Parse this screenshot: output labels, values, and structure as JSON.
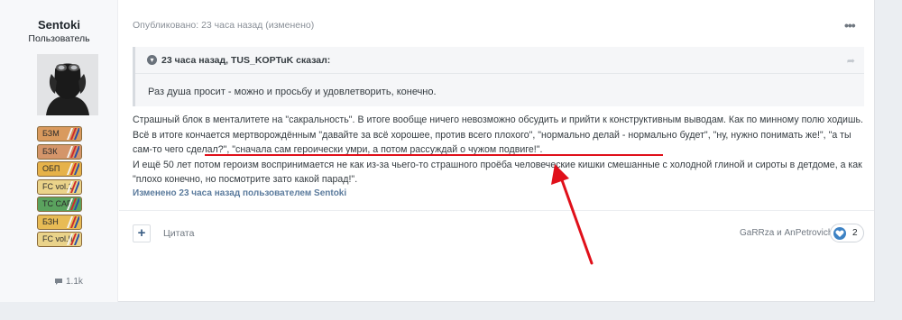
{
  "author": {
    "name": "Sentoki",
    "role": "Пользователь",
    "badges": [
      {
        "label": "БЗМ",
        "color": "#d99a5e"
      },
      {
        "label": "БЗК",
        "color": "#d4956a"
      },
      {
        "label": "ОБП",
        "color": "#e6b24a"
      },
      {
        "label": "FC vol.1",
        "color": "#ead38a"
      },
      {
        "label": "TC CAP",
        "color": "#5aa25e"
      },
      {
        "label": "БЗН",
        "color": "#e8bb55"
      },
      {
        "label": "FC vol.II",
        "color": "#ead38a"
      }
    ],
    "posts_count": "1.1k"
  },
  "post": {
    "meta": "Опубликовано: 23 часа назад (изменено)",
    "quote": {
      "header": "23 часа назад, TUS_KOPTuK сказал:",
      "body": "Раз душа просит - можно и просьбу и удовлетворить, конечно."
    },
    "paragraphs": [
      "Страшный блок в менталитете на \"сакральность\". В итоге вообще ничего невозможно обсудить и прийти к конструктивным выводам. Как по минному полю ходишь. Всё в итоге кончается мертворождённым \"давайте за всё хорошее, против всего плохого\", \"нормально делай - нормально будет\", \"ну, нужно понимать же!\", \"а ты сам-то чего сделал?\", \"сначала сам героически умри, а потом рассуждай о чужом подвиге!\".",
      "И ещё 50 лет потом героизм воспринимается не как из-за чьего-то страшного проёба человеческие кишки смешанные с холодной глиной и сироты в детдоме, а как \"плохо конечно, но посмотрите зато какой парад!\"."
    ],
    "edited": "Изменено 23 часа назад пользователем Sentoki"
  },
  "footer": {
    "quote_label": "Цитата",
    "reactors": "GaRRza и AnPetrovich",
    "reaction_count": "2"
  }
}
